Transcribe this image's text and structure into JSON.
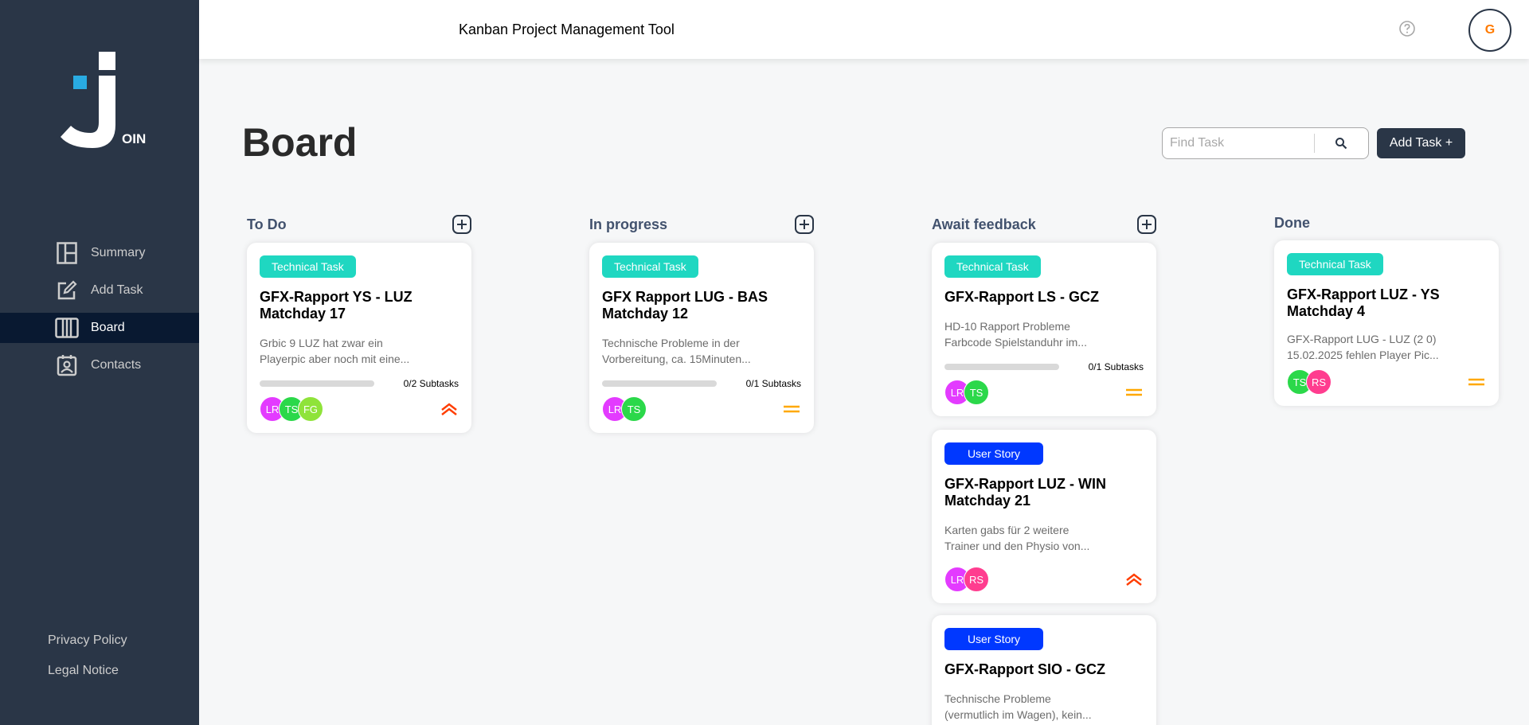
{
  "app": {
    "header_title": "Kanban Project Management Tool",
    "user_initial": "G",
    "logo_letters": "OIN"
  },
  "nav": {
    "items": [
      {
        "label": "Summary",
        "icon": "summary-icon"
      },
      {
        "label": "Add Task",
        "icon": "add-task-icon"
      },
      {
        "label": "Board",
        "icon": "board-icon",
        "active": true
      },
      {
        "label": "Contacts",
        "icon": "contacts-icon"
      }
    ],
    "privacy": "Privacy Policy",
    "legal": "Legal Notice"
  },
  "board": {
    "title": "Board",
    "search_placeholder": "Find Task",
    "add_task_label": "Add Task +"
  },
  "columns": [
    {
      "title": "To Do"
    },
    {
      "title": "In progress"
    },
    {
      "title": "Await feedback"
    },
    {
      "title": "Done"
    }
  ],
  "cards": [
    {
      "column": "To Do",
      "category": "Technical Task",
      "title": "GFX-Rapport YS - LUZ Matchday 17",
      "description": "Grbic 9 LUZ hat zwar ein Playerpic aber noch mit eine...",
      "subtasks": "0/2 Subtasks",
      "progress": 0,
      "assignees": [
        "LR",
        "TS",
        "FG"
      ],
      "priority": "urgent"
    },
    {
      "column": "In progress",
      "category": "Technical Task",
      "title": "GFX Rapport LUG - BAS Matchday 12",
      "description": "Technische Probleme in der Vorbereitung, ca. 15Minuten...",
      "subtasks": "0/1 Subtasks",
      "progress": 0,
      "assignees": [
        "LR",
        "TS"
      ],
      "priority": "medium"
    },
    {
      "column": "Await feedback",
      "category": "Technical Task",
      "title": "GFX-Rapport LS - GCZ",
      "description": "HD-10 Rapport Probleme Farbcode Spielstanduhr im...",
      "subtasks": "0/1 Subtasks",
      "progress": 0,
      "assignees": [
        "LR",
        "TS"
      ],
      "priority": "medium"
    },
    {
      "column": "Await feedback",
      "category": "User Story",
      "title": "GFX-Rapport LUZ - WIN Matchday 21",
      "description": "Karten gabs für 2 weitere Trainer und den Physio von...",
      "assignees": [
        "LR",
        "RS"
      ],
      "priority": "urgent"
    },
    {
      "column": "Await feedback",
      "category": "User Story",
      "title": "GFX-Rapport SIO - GCZ",
      "description": "Technische Probleme (vermutlich im Wagen), kein..."
    },
    {
      "column": "Done",
      "category": "Technical Task",
      "title": "GFX-Rapport LUZ - YS Matchday 4",
      "description": "GFX-Rapport LUG - LUZ (2 0) 15.02.2025 fehlen Player Pic...",
      "assignees": [
        "TS",
        "RS"
      ],
      "priority": "medium"
    }
  ],
  "colors": {
    "sidebar": "#2a3647",
    "nav_active": "#091931",
    "technical_task": "#1fd7c1",
    "user_story": "#0038ff",
    "urgent": "#ff3d00",
    "medium": "#ffa800",
    "avatar_LR": "#e33bff",
    "avatar_TS": "#2bd84a",
    "avatar_FG": "#8fe33a",
    "avatar_RS": "#ff3d8f"
  }
}
